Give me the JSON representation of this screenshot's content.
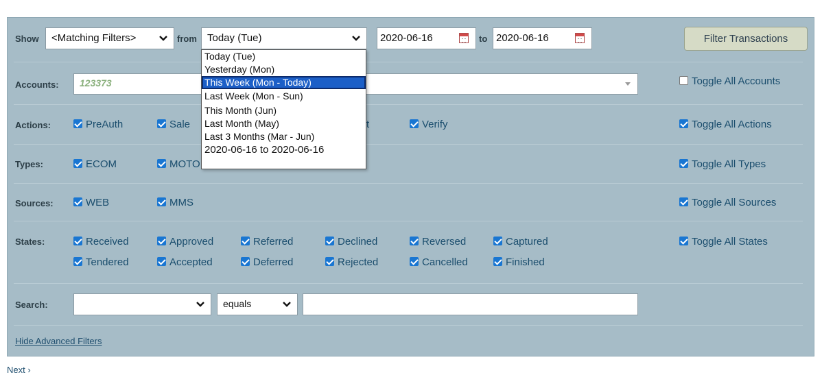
{
  "header": {
    "show_label": "Show",
    "show_select": "<Matching Filters>",
    "from_label": "from",
    "from_select": "Today (Tue)",
    "date_from": "2020-06-16",
    "to_label": "to",
    "date_to": "2020-06-16",
    "filter_button": "Filter Transactions"
  },
  "dropdown": {
    "options": [
      "Today (Tue)",
      "Yesterday (Mon)",
      "This Week (Mon - Today)",
      "Last Week (Mon - Sun)",
      "This Month (Jun)",
      "Last Month (May)",
      "Last 3 Months (Mar - Jun)",
      "2020-06-16 to 2020-06-16"
    ],
    "highlighted": "This Week (Mon - Today)"
  },
  "accounts": {
    "label": "Accounts:",
    "value": "123373",
    "toggle": "Toggle All Accounts"
  },
  "actions": {
    "label": "Actions:",
    "items": [
      "PreAuth",
      "Sale",
      "t",
      "Verify"
    ],
    "toggle": "Toggle All Actions"
  },
  "types": {
    "label": "Types:",
    "items": [
      "ECOM",
      "MOTO"
    ],
    "toggle": "Toggle All Types"
  },
  "sources": {
    "label": "Sources:",
    "items": [
      "WEB",
      "MMS"
    ],
    "toggle": "Toggle All Sources"
  },
  "states": {
    "label": "States:",
    "row1": [
      "Received",
      "Approved",
      "Referred",
      "Declined",
      "Reversed",
      "Captured"
    ],
    "row2": [
      "Tendered",
      "Accepted",
      "Deferred",
      "Rejected",
      "Cancelled",
      "Finished"
    ],
    "toggle": "Toggle All States"
  },
  "search": {
    "label": "Search:",
    "field_value": "",
    "operator": "equals",
    "value": ""
  },
  "hide_link": "Hide Advanced Filters",
  "next": "Next",
  "colors": {
    "panel": "#a6bcc7",
    "checkbox": "#1976d2",
    "highlight": "#1c5fc7"
  }
}
